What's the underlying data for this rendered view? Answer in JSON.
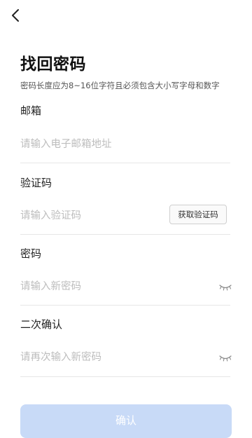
{
  "header": {
    "back_icon": "chevron-left-icon"
  },
  "title": "找回密码",
  "hint": "密码长度应为8~16位字符且必须包含大小写字母和数字",
  "email": {
    "label": "邮箱",
    "placeholder": "请输入电子邮箱地址"
  },
  "code": {
    "label": "验证码",
    "placeholder": "请输入验证码",
    "button_label": "获取验证码"
  },
  "password": {
    "label": "密码",
    "placeholder": "请输入新密码",
    "toggle_icon": "eye-closed-icon"
  },
  "confirm_password": {
    "label": "二次确认",
    "placeholder": "请再次输入新密码",
    "toggle_icon": "eye-closed-icon"
  },
  "submit": {
    "label": "确认"
  },
  "colors": {
    "accent_disabled": "#c8daf7",
    "placeholder": "#bdbdbd",
    "divider": "#e6e6e6"
  }
}
